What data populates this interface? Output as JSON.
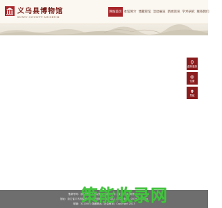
{
  "header": {
    "title": "义乌县博物馆",
    "subtitle": "XUWU COUNTY MUSEUM",
    "nav": [
      {
        "label": "网站首页",
        "active": true
      },
      {
        "label": "本馆简介",
        "active": false
      },
      {
        "label": "博藏空馆",
        "active": false
      },
      {
        "label": "活动展览",
        "active": false
      },
      {
        "label": "新闻资讯",
        "active": false
      },
      {
        "label": "学术研究",
        "active": false
      },
      {
        "label": "联系我们",
        "active": false
      }
    ]
  },
  "float_tools": [
    {
      "label": "虚拟漫游",
      "icon": "location-pin-icon"
    },
    {
      "label": "位置",
      "icon": "globe-icon"
    },
    {
      "label": "导航",
      "icon": "map-pin-icon"
    }
  ],
  "footer": {
    "line1": "备案号码：浙ICP备… | 网站首页 | 版权所有 | 技术支持 | 联系方式",
    "line2": "馆址：浙江省义乌市稠城街道 | 开放时间：09:00-17:00 | 电话：0579-xxxxxxx",
    "line3": "邮编：322000 | 馆藏精品 | 社会教育 | Copyright 2023"
  },
  "watermark": {
    "text": "策能收录网",
    "sub": "ceneng.com"
  },
  "colors": {
    "brand_red": "#a8262a",
    "tool_red": "#8a1c1d",
    "footer_gray": "#6e6e6e",
    "watermark_green": "#43c43f"
  }
}
